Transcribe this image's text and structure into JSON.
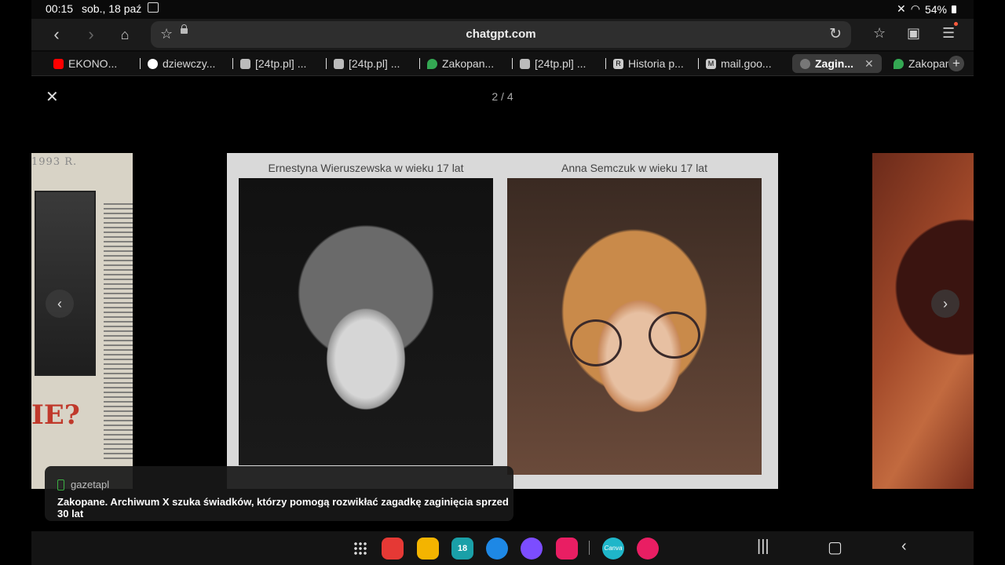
{
  "status": {
    "time": "00:15",
    "date": "sob., 18 paź",
    "battery": "54%"
  },
  "browser": {
    "url": "chatgpt.com"
  },
  "tabs": [
    {
      "label": "EKONO...",
      "favicon": "youtube-icon",
      "color": "#ff0000"
    },
    {
      "label": "dziewczy...",
      "favicon": "google-icon",
      "color": "#4285f4"
    },
    {
      "label": "[24tp.pl] ...",
      "favicon": "24tp-icon",
      "color": "#dddddd"
    },
    {
      "label": "[24tp.pl] ...",
      "favicon": "24tp-icon",
      "color": "#dddddd"
    },
    {
      "label": "Zakopan...",
      "favicon": "maps-pin-icon",
      "color": "#34a853"
    },
    {
      "label": "[24tp.pl] ...",
      "favicon": "24tp-icon",
      "color": "#dddddd"
    },
    {
      "label": "Historia p...",
      "favicon": "r-icon",
      "color": "#cccccc"
    },
    {
      "label": "mail.goo...",
      "favicon": "m-icon",
      "color": "#cccccc"
    },
    {
      "label": "Zagin...",
      "favicon": "openai-icon",
      "color": "#999999",
      "active": true
    },
    {
      "label": "Zakopan",
      "favicon": "maps-pin-icon",
      "color": "#34a853"
    }
  ],
  "viewer": {
    "counter": "2 / 4",
    "left_year": "1993 R.",
    "left_headline": "IE?",
    "image": {
      "caption_left": "Ernestyna Wieruszewska w wieku 17 lat",
      "caption_right": "Anna Semczuk w wieku 17 lat"
    },
    "source": "gazetapl",
    "title": "Zakopane. Archiwum X szuka świadków, którzy pomogą rozwikłać zagadkę zaginięcia sprzed 30 lat"
  },
  "taskbar": {
    "apps": [
      {
        "name": "flipboard-app-icon",
        "color": "#e53935"
      },
      {
        "name": "files-app-icon",
        "color": "#f4b400"
      },
      {
        "name": "calendar-app-icon",
        "color": "#1aa0a8",
        "text": "18"
      },
      {
        "name": "messages-app-icon",
        "color": "#1e88e5"
      },
      {
        "name": "browser-app-icon",
        "color": "#7c4dff"
      },
      {
        "name": "camera-app-icon",
        "color": "#e91e63"
      },
      {
        "name": "canva-app-icon",
        "color": "#1fb6c9",
        "text": "Canva"
      },
      {
        "name": "blossom-app-icon",
        "color": "#e91e63"
      }
    ]
  }
}
